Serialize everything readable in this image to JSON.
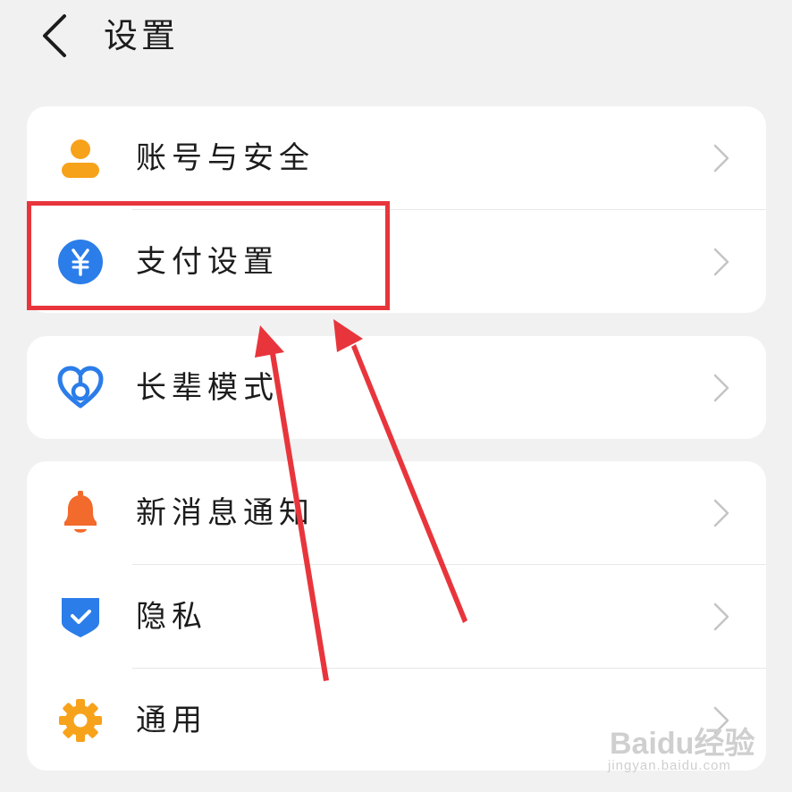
{
  "header": {
    "title": "设置",
    "back_icon": "chevron-left-icon"
  },
  "groups": [
    {
      "items": [
        {
          "label": "账号与安全",
          "icon": "person-icon",
          "color": "#f7a21b"
        },
        {
          "label": "支付设置",
          "icon": "yuan-icon",
          "color": "#2b7de9"
        }
      ]
    },
    {
      "items": [
        {
          "label": "长辈模式",
          "icon": "heart-icon",
          "color": "#2b7de9"
        }
      ]
    },
    {
      "items": [
        {
          "label": "新消息通知",
          "icon": "bell-icon",
          "color": "#f26a2c"
        },
        {
          "label": "隐私",
          "icon": "shield-check-icon",
          "color": "#2b7de9"
        },
        {
          "label": "通用",
          "icon": "gear-icon",
          "color": "#f7a21b"
        }
      ]
    }
  ],
  "annotation": {
    "highlight_color": "#e8353c",
    "highlighted_item": "支付设置"
  },
  "watermark": {
    "brand": "Baidu经验",
    "site": "jingyan.baidu.com"
  }
}
